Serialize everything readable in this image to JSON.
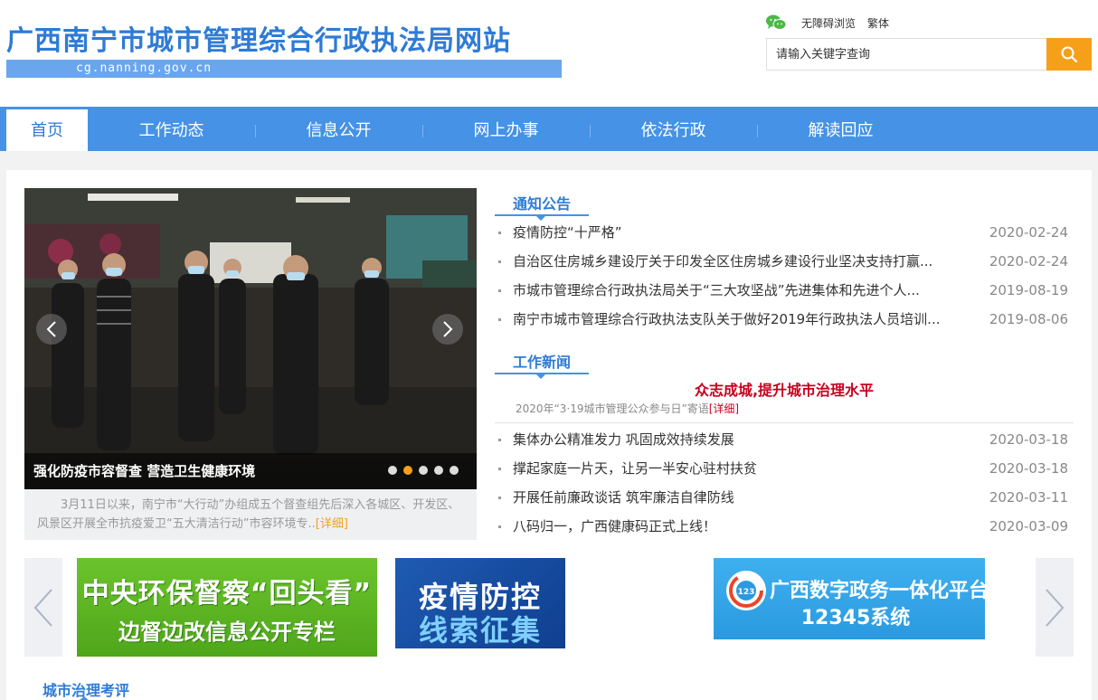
{
  "site": {
    "title": "广西南宁市城市管理综合行政执法局网站",
    "domain": "cg.nanning.gov.cn"
  },
  "top_links": {
    "accessibility": "无障碍浏览",
    "traditional": "繁体"
  },
  "search": {
    "placeholder": "请输入关键字查询"
  },
  "nav": {
    "items": [
      {
        "label": "首页",
        "active": true
      },
      {
        "label": "工作动态"
      },
      {
        "label": "信息公开"
      },
      {
        "label": "网上办事"
      },
      {
        "label": "依法行政"
      },
      {
        "label": "解读回应"
      }
    ]
  },
  "slider": {
    "caption": "强化防疫市容督查 营造卫生健康环境",
    "summary": "3月11日以来，南宁市“大行动”办组成五个督查组先后深入各城区、开发区、风景区开展全市抗疫爱卫“五大清洁行动”市容环境专..",
    "detail_label": "[详细]",
    "active_dot_index": 1,
    "dot_count": 5
  },
  "notices": {
    "title": "通知公告",
    "items": [
      {
        "title": "疫情防控“十严格”",
        "date": "2020-02-24"
      },
      {
        "title": "自治区住房城乡建设厅关于印发全区住房城乡建设行业坚决支持打赢...",
        "date": "2020-02-24"
      },
      {
        "title": "市城市管理综合行政执法局关于“三大攻坚战”先进集体和先进个人...",
        "date": "2019-08-19"
      },
      {
        "title": "南宁市城市管理综合行政执法支队关于做好2019年行政执法人员培训...",
        "date": "2019-08-06"
      }
    ]
  },
  "work_news": {
    "title": "工作新闻",
    "headline": "众志成城,提升城市治理水平",
    "headline_sub": "2020年“3·19城市管理公众参与日”寄语",
    "headline_detail": "[详细]",
    "items": [
      {
        "title": "集体办公精准发力 巩固成效持续发展",
        "date": "2020-03-18"
      },
      {
        "title": "撑起家庭一片天，让另一半安心驻村扶贫",
        "date": "2020-03-18"
      },
      {
        "title": "开展任前廉政谈话 筑牢廉洁自律防线",
        "date": "2020-03-11"
      },
      {
        "title": "八码归一，广西健康码正式上线！",
        "date": "2020-03-09"
      }
    ]
  },
  "banners": {
    "b1_line1": "中央环保督察“回头看”",
    "b1_line2": "边督边改信息公开专栏",
    "b2_line1": "疫情防控",
    "b2_line2": "线索征集",
    "b3_line1": "广西数字政务一体化平台",
    "b3_line2": "12345系统",
    "b3_badge": "123"
  },
  "bottom_section": {
    "title": "城市治理考评"
  },
  "colors": {
    "brand_blue": "#4592e6",
    "title_blue": "#2e7bd6",
    "accent_orange": "#f6a01a",
    "headline_red": "#c8001e"
  }
}
